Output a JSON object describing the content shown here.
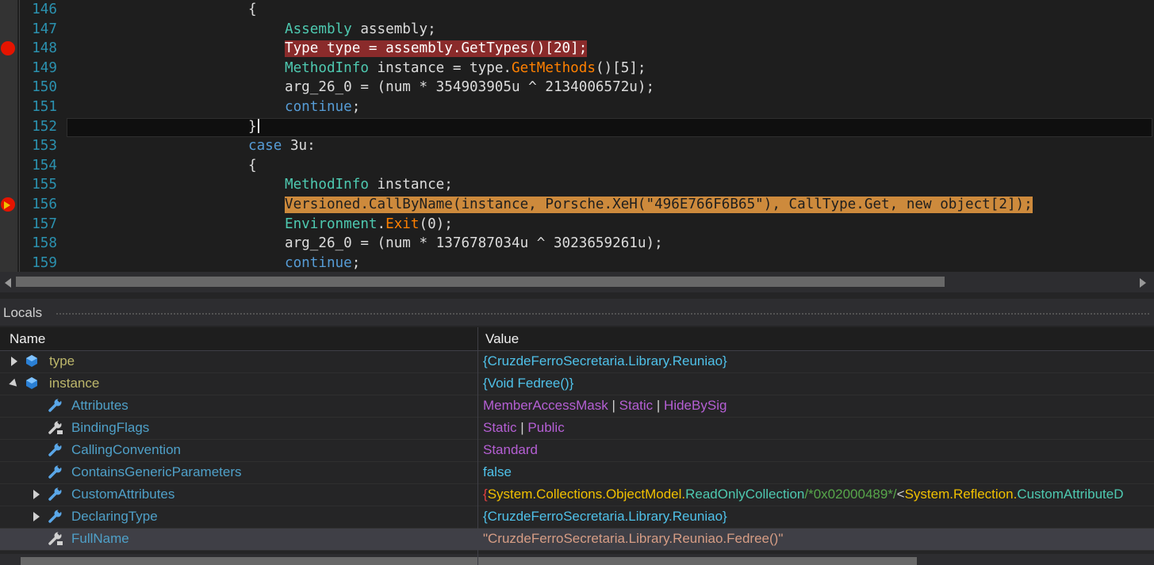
{
  "editor": {
    "lines": [
      {
        "no": "146",
        "tokens": [
          {
            "t": "{",
            "c": "#dcdcdc"
          }
        ]
      },
      {
        "no": "147",
        "tokens": [
          {
            "t": "Assembly",
            "c": "#4ec9b0"
          },
          {
            "t": " assembly;",
            "c": "#dcdcdc"
          }
        ]
      },
      {
        "no": "148",
        "breakpoint": true,
        "highlight": "#8a2b2b",
        "tokens": [
          {
            "t": "Type type = assembly.GetTypes()[20];",
            "c": "#ffffff"
          }
        ]
      },
      {
        "no": "149",
        "tokens": [
          {
            "t": "MethodInfo",
            "c": "#4ec9b0"
          },
          {
            "t": " instance = type.",
            "c": "#dcdcdc"
          },
          {
            "t": "GetMethods",
            "c": "#ff8000"
          },
          {
            "t": "()[5];",
            "c": "#dcdcdc"
          }
        ]
      },
      {
        "no": "150",
        "tokens": [
          {
            "t": "arg_26_0 = (num * 354903905u ^ 2134006572u);",
            "c": "#dcdcdc"
          }
        ]
      },
      {
        "no": "151",
        "tokens": [
          {
            "t": "continue",
            "c": "#569cd6"
          },
          {
            "t": ";",
            "c": "#dcdcdc"
          }
        ]
      },
      {
        "no": "152",
        "current": true,
        "tokens": [
          {
            "t": "}",
            "c": "#dcdcdc"
          }
        ]
      },
      {
        "no": "153",
        "tokens": [
          {
            "t": "case",
            "c": "#569cd6"
          },
          {
            "t": " 3u:",
            "c": "#dcdcdc"
          }
        ]
      },
      {
        "no": "154",
        "tokens": [
          {
            "t": "{",
            "c": "#dcdcdc"
          }
        ]
      },
      {
        "no": "155",
        "tokens": [
          {
            "t": "MethodInfo",
            "c": "#4ec9b0"
          },
          {
            "t": " instance;",
            "c": "#dcdcdc"
          }
        ]
      },
      {
        "no": "156",
        "breakpoint": true,
        "arrow": true,
        "highlight": "#cd8a3c",
        "tokens": [
          {
            "t": "Versioned.CallByName(instance, Porsche.XeH(\"496E766F6B65\"), CallType.Get, new object[2]);",
            "c": "#1e1e1e"
          }
        ]
      },
      {
        "no": "157",
        "tokens": [
          {
            "t": "Environment",
            "c": "#4ec9b0"
          },
          {
            "t": ".",
            "c": "#dcdcdc"
          },
          {
            "t": "Exit",
            "c": "#ff8000"
          },
          {
            "t": "(0);",
            "c": "#dcdcdc"
          }
        ]
      },
      {
        "no": "158",
        "tokens": [
          {
            "t": "arg_26_0 = (num * 1376787034u ^ 3023659261u);",
            "c": "#dcdcdc"
          }
        ]
      },
      {
        "no": "159",
        "tokens": [
          {
            "t": "continue",
            "c": "#569cd6"
          },
          {
            "t": ";",
            "c": "#dcdcdc"
          }
        ]
      }
    ]
  },
  "locals": {
    "title": "Locals",
    "columns": {
      "name": "Name",
      "value": "Value"
    },
    "rows": [
      {
        "name": "type",
        "icon": "field-icon",
        "expander": "collapsed",
        "parts": [
          {
            "t": "{CruzdeFerroSecretaria.Library.Reuniao}",
            "c": "#4fc1e9"
          }
        ]
      },
      {
        "name": "instance",
        "icon": "field-icon",
        "expander": "expanded",
        "parts": [
          {
            "t": "{Void Fedree()}",
            "c": "#4fc1e9"
          }
        ]
      },
      {
        "name": "Attributes",
        "icon": "property-wrench-icon",
        "parts": [
          {
            "t": "MemberAccessMask",
            "c": "#b55fd4"
          },
          {
            "t": " | ",
            "c": "#d0d0d0"
          },
          {
            "t": "Static",
            "c": "#b55fd4"
          },
          {
            "t": " | ",
            "c": "#d0d0d0"
          },
          {
            "t": "HideBySig",
            "c": "#b55fd4"
          }
        ]
      },
      {
        "name": "BindingFlags",
        "icon": "property-wrench-lock-icon",
        "parts": [
          {
            "t": "Static",
            "c": "#b55fd4"
          },
          {
            "t": " | ",
            "c": "#d0d0d0"
          },
          {
            "t": "Public",
            "c": "#b55fd4"
          }
        ]
      },
      {
        "name": "CallingConvention",
        "icon": "property-wrench-icon",
        "parts": [
          {
            "t": "Standard",
            "c": "#b55fd4"
          }
        ]
      },
      {
        "name": "ContainsGenericParameters",
        "icon": "property-wrench-icon",
        "parts": [
          {
            "t": "false",
            "c": "#4fc1e9"
          }
        ]
      },
      {
        "name": "CustomAttributes",
        "icon": "property-wrench-icon",
        "expander": "collapsed",
        "parts": [
          {
            "t": "{",
            "c": "#e04040"
          },
          {
            "t": "System.Collections.ObjectModel.",
            "c": "#f0c000"
          },
          {
            "t": "ReadOnlyCollection",
            "c": "#4ec9b0"
          },
          {
            "t": "/*0x02000489*/",
            "c": "#57a64a"
          },
          {
            "t": "<",
            "c": "#d0d0d0"
          },
          {
            "t": "System.Reflection.",
            "c": "#f0c000"
          },
          {
            "t": "CustomAttributeD",
            "c": "#4ec9b0"
          }
        ]
      },
      {
        "name": "DeclaringType",
        "icon": "property-wrench-icon",
        "expander": "collapsed",
        "parts": [
          {
            "t": "{CruzdeFerroSecretaria.Library.Reuniao}",
            "c": "#4fc1e9"
          }
        ]
      },
      {
        "name": "FullName",
        "icon": "property-wrench-lock-icon",
        "selected": true,
        "parts": [
          {
            "t": "\"CruzdeFerroSecretaria.Library.Reuniao.Fedree()\"",
            "c": "#d69d85"
          }
        ]
      }
    ]
  },
  "colors": {
    "name_text": "#4fa0c8",
    "name_text_top": "#bdb76b",
    "line_number": "#2b91af",
    "breakpoint": "#e51400"
  }
}
